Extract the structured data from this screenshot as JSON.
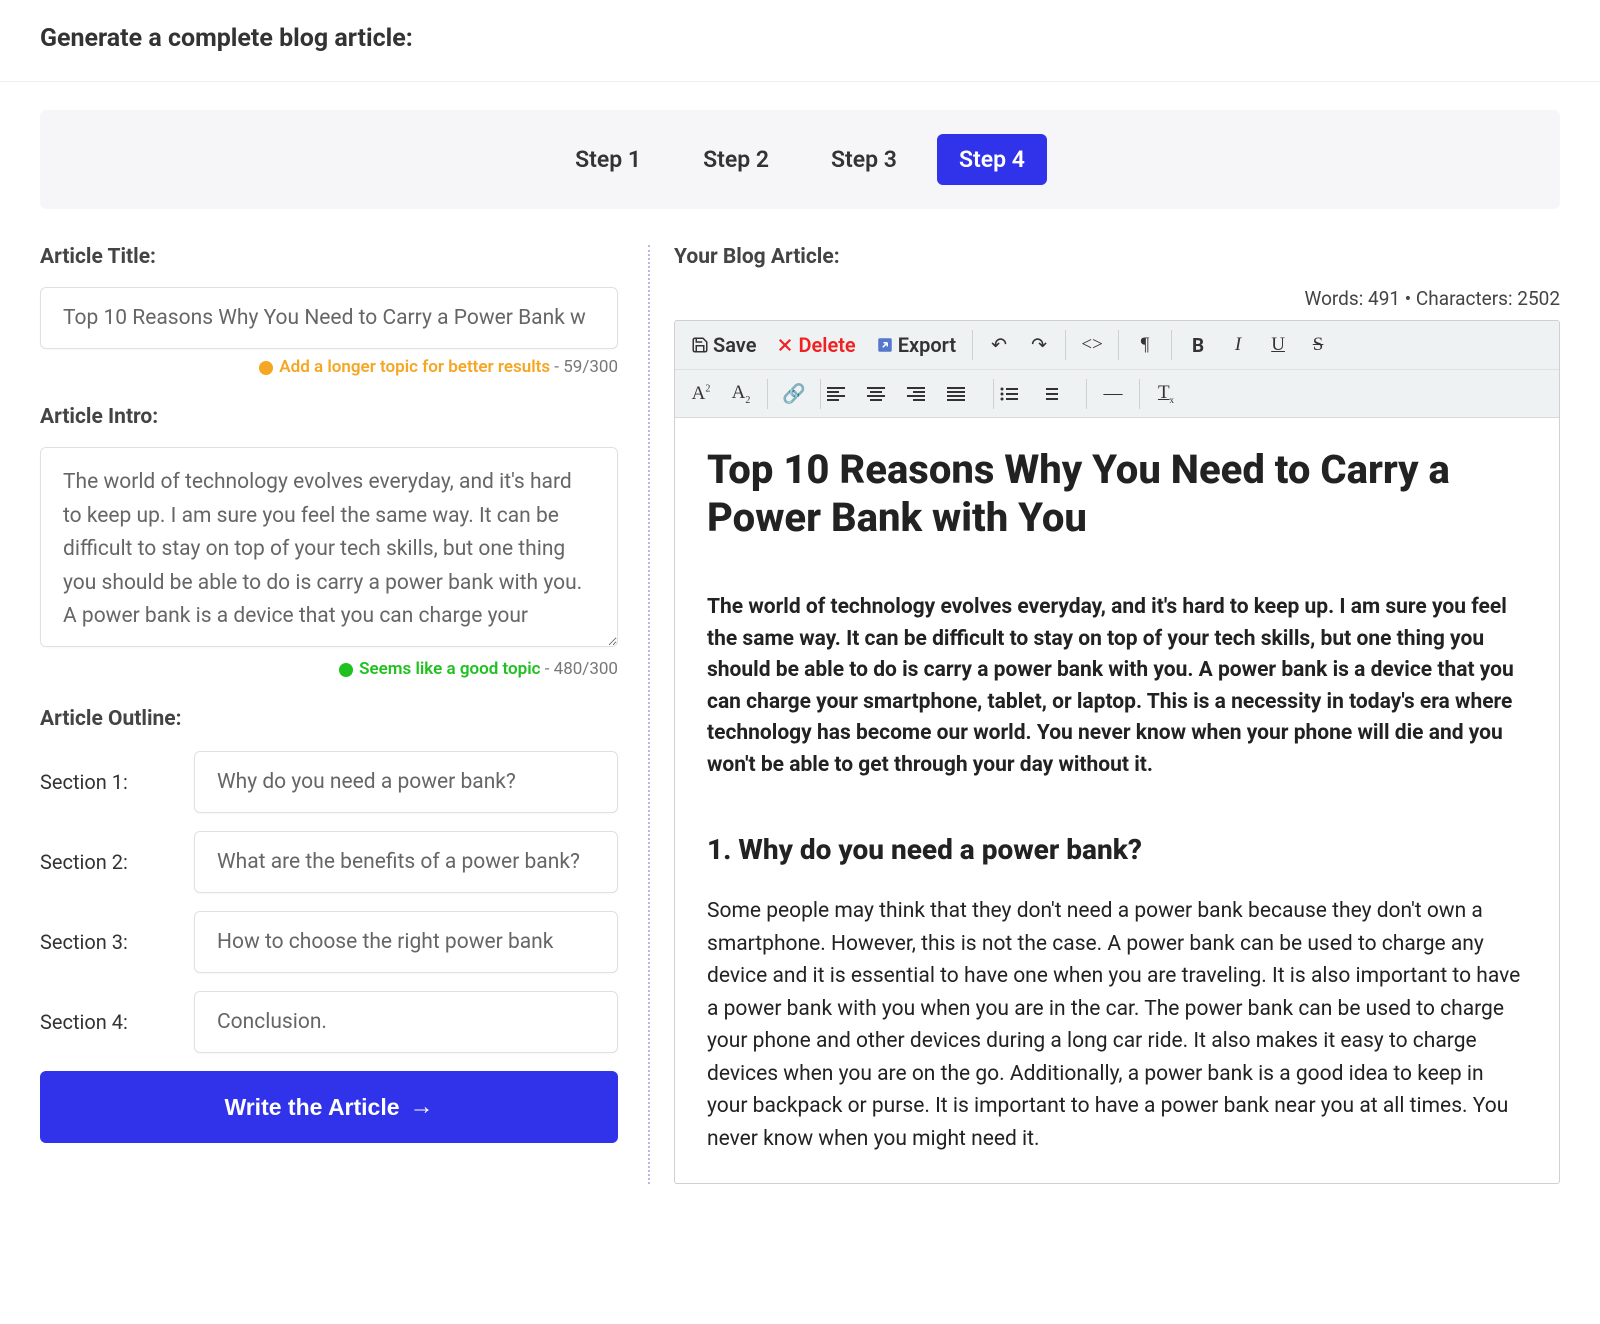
{
  "page_title": "Generate a complete blog article:",
  "steps": [
    "Step 1",
    "Step 2",
    "Step 3",
    "Step 4"
  ],
  "active_step": 3,
  "left": {
    "article_title_label": "Article Title:",
    "article_title_value": "Top 10 Reasons Why You Need to Carry a Power Bank w",
    "title_hint_text": "Add a longer topic for better results",
    "title_hint_count": " - 59/300",
    "article_intro_label": "Article Intro:",
    "article_intro_value": "The world of technology evolves everyday, and it's hard to keep up. I am sure you feel the same way. It can be difficult to stay on top of your tech skills, but one thing you should be able to do is carry a power bank with you. A power bank is a device that you can charge your",
    "intro_hint_text": "Seems like a good topic",
    "intro_hint_count": " - 480/300",
    "outline_label": "Article Outline:",
    "sections": [
      {
        "label": "Section 1:",
        "value": "Why do you need a power bank?"
      },
      {
        "label": "Section 2:",
        "value": "What are the benefits of a power bank?"
      },
      {
        "label": "Section 3:",
        "value": "How to choose the right power bank"
      },
      {
        "label": "Section 4:",
        "value": "Conclusion."
      }
    ],
    "write_button": "Write the Article"
  },
  "right": {
    "header": "Your Blog Article:",
    "words_label": "Words: ",
    "words": "491",
    "sep": " • ",
    "chars_label": "Characters: ",
    "chars": "2502",
    "toolbar": {
      "save": "Save",
      "delete": "Delete",
      "export": "Export"
    },
    "article": {
      "title": "Top 10 Reasons Why You Need to Carry a Power Bank with You",
      "lead": "The world of technology evolves everyday, and it's hard to keep up. I am sure you feel the same way. It can be difficult to stay on top of your tech skills, but one thing you should be able to do is carry a power bank with you. A power bank is a device that you can charge your smartphone, tablet, or laptop. This is a necessity in today's era where technology has become our world. You never know when your phone will die and you won't be able to get through your day without it.",
      "h2": "1. Why do you need a power bank?",
      "body": "Some people may think that they don't need a power bank because they don't own a smartphone. However, this is not the case. A power bank can be used to charge any device and it is essential to have one when you are traveling. It is also important to have a power bank with you when you are in the car. The power bank can be used to charge your phone and other devices during a long car ride. It also makes it easy to charge devices when you are on the go. Additionally, a power bank is a good idea to keep in your backpack or purse. It is important to have a power bank near you at all times. You never know when you might need it."
    }
  }
}
